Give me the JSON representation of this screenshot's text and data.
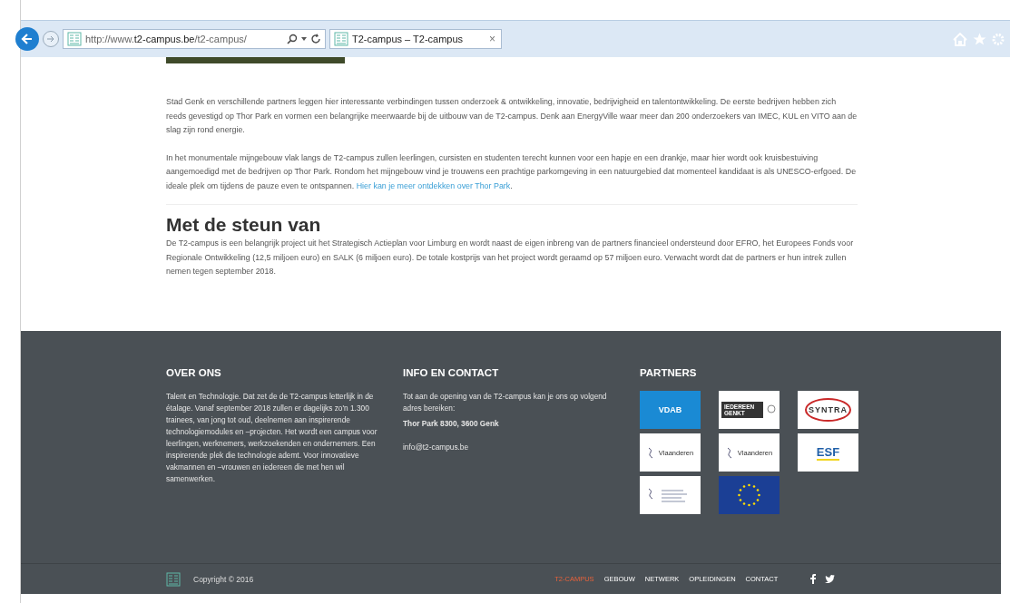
{
  "browser": {
    "url": "http://www.**t2-campus.be**/t2-campus/",
    "tab": {
      "title": "T2-campus – T2-campus",
      "close": "×",
      "selected": true
    }
  },
  "content": {
    "paragraphs": [
      {
        "text": "Stad Genk en verschillende partners leggen hier interessante verbindingen tussen onderzoek & ontwikkeling, innovatie, bedrijvigheid en talentontwikkeling. De eerste bedrijven hebben zich reeds gevestigd op Thor Park en vormen een belangrijke meerwaarde bij de uitbouw van de T2-campus. Denk aan EnergyVille waar meer dan 200 onderzoekers van IMEC, KUL en VITO aan de slag zijn rond energie."
      },
      {
        "text": "In het monumentale mijngebouw vlak langs de T2-campus zullen leerlingen, cursisten en studenten terecht kunnen voor een hapje en een drankje, maar hier wordt ook kruisbestuiving aangemoedigd met de bedrijven op Thor Park. Rondom het mijngebouw vind je trouwens een prachtige parkomgeving in een natuurgebied dat momenteel kandidaat is als UNESCO-erfgoed. De ideale plek om tijdens de pauze even te ontspannen.",
        "link": "Hier kan je meer ontdekken over Thor Park",
        "after": "."
      }
    ],
    "heading": "Met de steun van",
    "support_text": "De T2-campus is een belangrijk project uit het Strategisch Actieplan voor Limburg en wordt naast de eigen inbreng van de partners financieel ondersteund door EFRO, het Europees Fonds voor Regionale Ontwikkeling (12,5 miljoen euro) en SALK (6 miljoen euro). De totale kostprijs van het project wordt geraamd op 57 miljoen euro. Verwacht wordt dat de partners er hun intrek zullen nemen tegen september 2018."
  },
  "footer": {
    "about": {
      "title": "OVER ONS",
      "text": "Talent en Technologie. Dat zet de de T2-campus letterlijk in de étalage. Vanaf september 2018 zullen er dagelijks zo'n 1.300 trainees, van jong tot oud, deelnemen aan inspirerende technologiemodules en –projecten. Het wordt een campus voor leerlingen, werknemers, werkzoekenden en ondernemers. Een inspirerende plek die technologie ademt. Voor innovatieve vakmannen en –vrouwen en iedereen die met hen wil samenwerken."
    },
    "contact": {
      "title": "INFO EN CONTACT",
      "text": "Tot aan de opening van de T2-campus kan je ons op volgend adres bereiken:",
      "address": "Thor Park 8300, 3600 Genk",
      "email": "info@t2-campus.be"
    },
    "partners": {
      "title": "PARTNERS",
      "logos": [
        {
          "kind": "vdab",
          "name": "VDAB"
        },
        {
          "kind": "genkt",
          "name": "IEDEREEN GENKT"
        },
        {
          "kind": "syntra",
          "name": "SYNTRA"
        },
        {
          "kind": "vlaanderen",
          "name": "Vlaanderen"
        },
        {
          "kind": "vlaanderen",
          "name": "Vlaanderen"
        },
        {
          "kind": "esf",
          "name": "ESF"
        },
        {
          "kind": "vlaanderen-small"
        },
        {
          "kind": "eu"
        }
      ]
    },
    "copyright": "Copyright © 2016",
    "nav": [
      {
        "label": "T2-CAMPUS",
        "selected": true
      },
      {
        "label": "GEBOUW",
        "selected": false
      },
      {
        "label": "NETWERK",
        "selected": false
      },
      {
        "label": "OPLEIDINGEN",
        "selected": false
      },
      {
        "label": "CONTACT",
        "selected": false
      }
    ]
  }
}
